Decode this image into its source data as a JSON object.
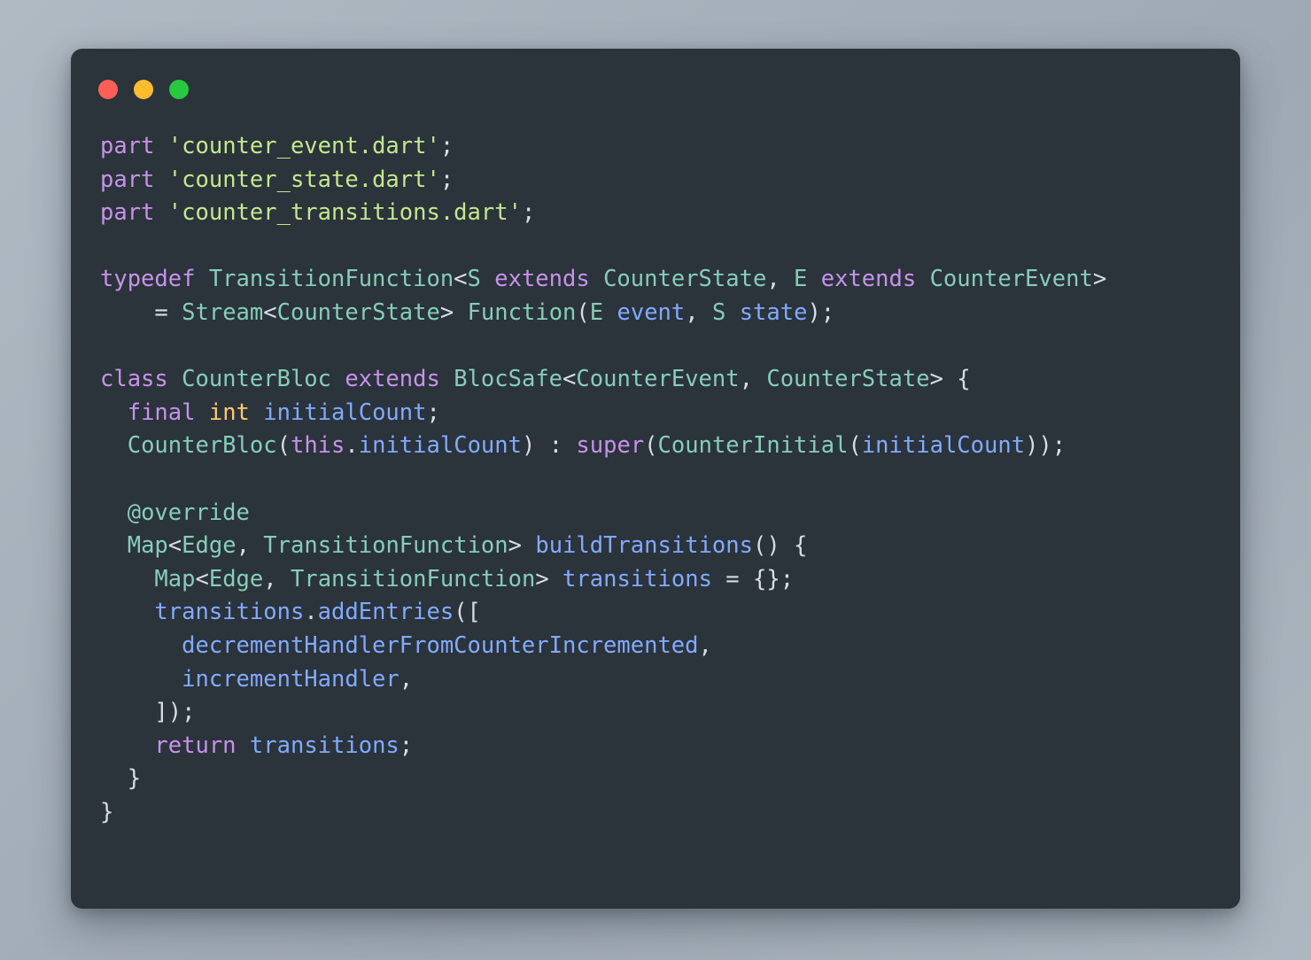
{
  "window": {
    "type": "code-screenshot-window",
    "background_color": "#2b333b",
    "page_background_color": "#a8b2bc",
    "traffic_lights": [
      {
        "name": "close-button",
        "color": "#ff5f56"
      },
      {
        "name": "minimize-button",
        "color": "#ffbd2e"
      },
      {
        "name": "maximize-button",
        "color": "#27c93f"
      }
    ]
  },
  "editor": {
    "language": "dart",
    "font_size_px": 25,
    "colors": {
      "keyword": "#c792ea",
      "string": "#c3e88d",
      "type": "#86ceb9",
      "identifier": "#82aaff",
      "number": "#ffcb6b",
      "punctuation": "#d6dde5"
    },
    "code_lines": [
      "part 'counter_event.dart';",
      "part 'counter_state.dart';",
      "part 'counter_transitions.dart';",
      "",
      "typedef TransitionFunction<S extends CounterState, E extends CounterEvent>",
      "    = Stream<CounterState> Function(E event, S state);",
      "",
      "class CounterBloc extends BlocSafe<CounterEvent, CounterState> {",
      "  final int initialCount;",
      "  CounterBloc(this.initialCount) : super(CounterInitial(initialCount));",
      "",
      "  @override",
      "  Map<Edge, TransitionFunction> buildTransitions() {",
      "    Map<Edge, TransitionFunction> transitions = {};",
      "    transitions.addEntries([",
      "      decrementHandlerFromCounterIncremented,",
      "      incrementHandler,",
      "    ]);",
      "    return transitions;",
      "  }",
      "}"
    ],
    "tokens": {
      "part": "part",
      "typedef": "typedef",
      "class": "class",
      "extends": "extends",
      "final": "final",
      "int": "int",
      "this": "this",
      "super": "super",
      "return": "return",
      "override_annotation": "@override",
      "string_counter_event": "'counter_event.dart'",
      "string_counter_state": "'counter_state.dart'",
      "string_counter_transitions": "'counter_transitions.dart'",
      "type_TransitionFunction": "TransitionFunction",
      "type_CounterState": "CounterState",
      "type_CounterEvent": "CounterEvent",
      "type_CounterBloc": "CounterBloc",
      "type_BlocSafe": "BlocSafe",
      "type_Stream": "Stream",
      "type_Function": "Function",
      "type_Map": "Map",
      "type_Edge": "Edge",
      "type_CounterInitial": "CounterInitial",
      "ident_S": "S",
      "ident_E": "E",
      "ident_event": "event",
      "ident_state": "state",
      "ident_initialCount": "initialCount",
      "ident_buildTransitions": "buildTransitions",
      "ident_transitions": "transitions",
      "ident_addEntries": "addEntries",
      "ident_decrementHandler": "decrementHandlerFromCounterIncremented",
      "ident_incrementHandler": "incrementHandler"
    }
  }
}
